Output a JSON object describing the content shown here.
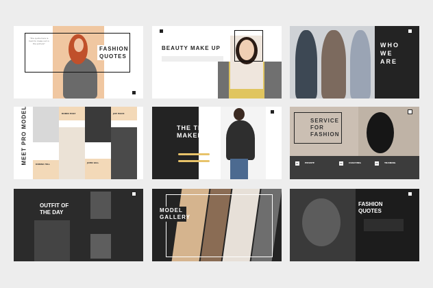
{
  "colors": {
    "accent": "#e8c36a",
    "dark": "#222222",
    "gray": "#6f6f6f",
    "beige": "#f3d9b8"
  },
  "slides": {
    "s1": {
      "title": "FASHION QUOTES",
      "quote": "\"the quote here is hard to make out in the picture\""
    },
    "s2": {
      "title": "BEAUTY MAKE UP"
    },
    "s3": {
      "title": "WHO WE ARE"
    },
    "s4": {
      "title": "MEET PRO MODEL",
      "names": [
        "ROBIN HOLT",
        "JOE MACK",
        "DONNA HILL",
        "JOHN GILL"
      ]
    },
    "s5": {
      "title": "THE TREND MAKER"
    },
    "s6": {
      "title": "SERVICE FOR FASHION",
      "items": [
        "PRIVATE",
        "COACHING",
        "TRAINING"
      ],
      "nums": [
        "01",
        "02",
        "03"
      ]
    },
    "s7": {
      "title": "OUTFIT OF THE DAY"
    },
    "s8": {
      "title": "MODEL GALLERY"
    },
    "s9": {
      "title": "FASHION QUOTES"
    }
  },
  "icons": {
    "logo": "logo-square-icon"
  }
}
